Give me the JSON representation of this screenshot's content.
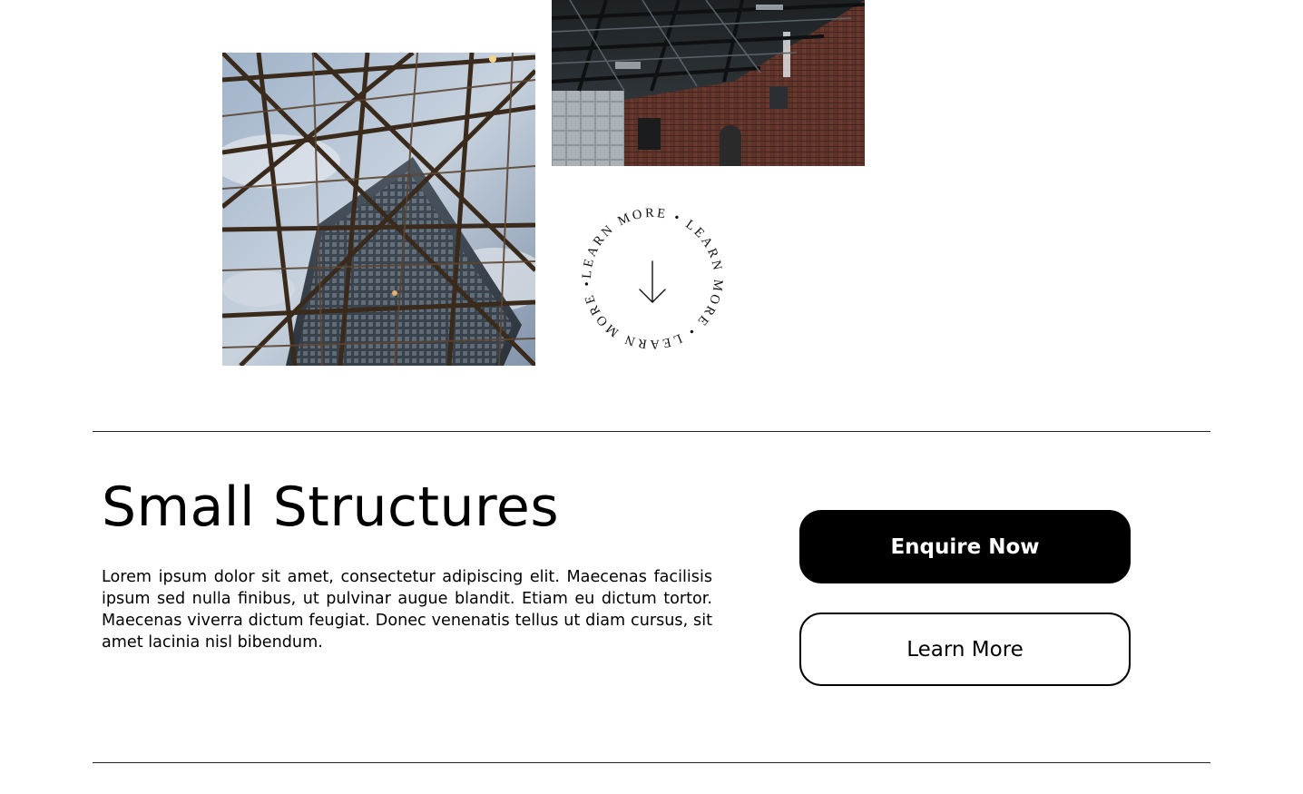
{
  "gallery": {
    "images": [
      {
        "subject": "glass-lattice-atrium-photo"
      },
      {
        "subject": "industrial-brick-hall-photo"
      }
    ]
  },
  "learn_badge": {
    "ring_text": "LEARN MORE • LEARN MORE • LEARN MORE • ",
    "icon": "arrow-down-icon"
  },
  "section": {
    "title": "Small Structures",
    "body": "Lorem ipsum dolor sit amet, consectetur adipiscing elit. Maecenas facilisis ipsum sed nulla finibus, ut pulvinar augue blandit. Etiam eu dictum tortor. Maecenas viverra dictum feugiat. Donec venenatis tellus ut diam cursus, sit amet lacinia nisl bibendum."
  },
  "actions": {
    "enquire_label": "Enquire Now",
    "learn_label": "Learn More"
  },
  "colors": {
    "text": "#000000",
    "background": "#ffffff",
    "primary_button": "#000000"
  }
}
